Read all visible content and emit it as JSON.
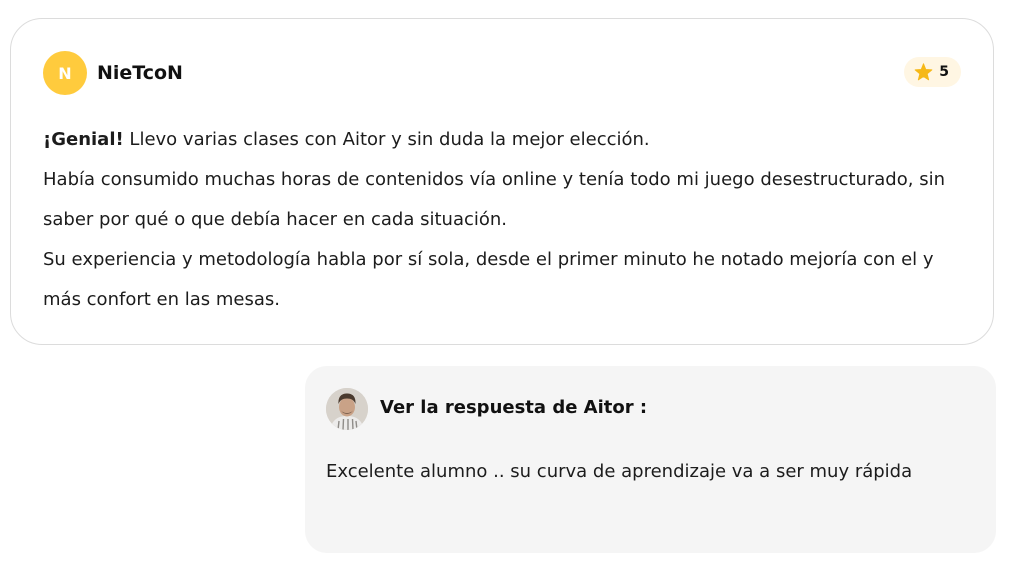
{
  "review": {
    "author_initial": "N",
    "author_name": "NieTcoN",
    "rating": "5",
    "rating_icon": "star-icon",
    "headline": "¡Genial!",
    "first_line_rest": " Llevo varias clases con Aitor y sin duda la mejor elección.",
    "paragraph_2": "Había consumido muchas horas de contenidos vía online y tenía todo mi juego desestructurado, sin saber por qué o que debía hacer en cada situación.",
    "paragraph_3": "Su experiencia y metodología habla por sí sola, desde el primer minuto he notado mejoría con el y más confort en las mesas."
  },
  "reply": {
    "title": "Ver la respuesta de Aitor :",
    "text": "Excelente alumno .. su curva de aprendizaje va a ser muy rápida"
  },
  "colors": {
    "avatar_bg": "#ffcb3d",
    "star": "#f6b817",
    "rating_badge_bg": "#fff6e3",
    "reply_bg": "#f5f5f5",
    "card_border": "#dcdcdc"
  }
}
